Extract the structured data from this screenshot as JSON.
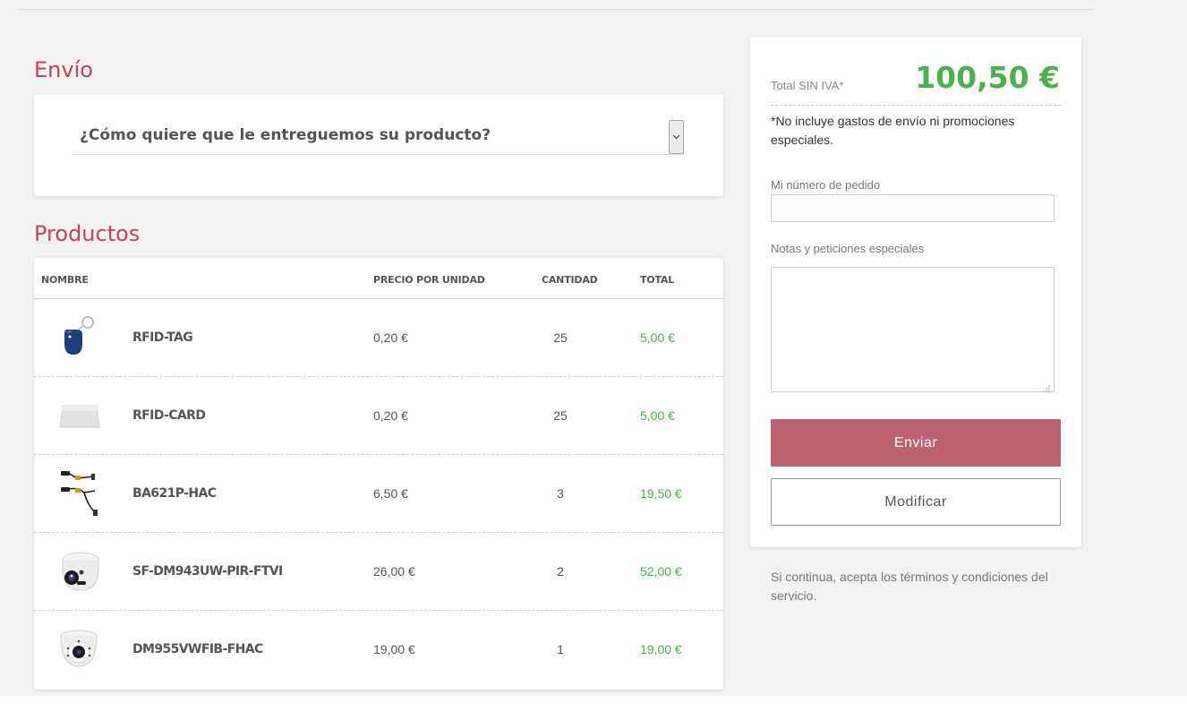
{
  "shipping": {
    "title": "Envío",
    "select_label": "¿Cómo quiere que le entreguemos su producto?"
  },
  "products": {
    "title": "Productos",
    "columns": {
      "name": "NOMBRE",
      "unit_price": "PRECIO POR UNIDAD",
      "quantity": "CANTIDAD",
      "total": "TOTAL"
    },
    "rows": [
      {
        "name": "RFID-TAG",
        "unit_price": "0,20 €",
        "quantity": "25",
        "total": "5,00 €",
        "image": "rfid-keyfob"
      },
      {
        "name": "RFID-CARD",
        "unit_price": "0,20 €",
        "quantity": "25",
        "total": "5,00 €",
        "image": "rfid-card"
      },
      {
        "name": "BA621P-HAC",
        "unit_price": "6,50 €",
        "quantity": "3",
        "total": "19,50 €",
        "image": "video-balun-cables"
      },
      {
        "name": "SF-DM943UW-PIR-FTVI",
        "unit_price": "26,00 €",
        "quantity": "2",
        "total": "52,00 €",
        "image": "turret-camera"
      },
      {
        "name": "DM955VWFIB-FHAC",
        "unit_price": "19,00 €",
        "quantity": "1",
        "total": "19,00 €",
        "image": "dome-camera"
      }
    ]
  },
  "summary": {
    "total_label": "Total SIN IVA*",
    "total_value": "100,50 €",
    "note": "*No incluye gastos de envío ni promociones especiales.",
    "order_number_label": "Mi número de pedido",
    "order_number_value": "",
    "notes_label": "Notas y peticiones especiales",
    "notes_value": "",
    "send_label": "Enviar",
    "modify_label": "Modificar"
  },
  "terms": "Si continua, acepta los términos y condiciones del servicio.",
  "colors": {
    "accent": "#c2415c",
    "price_green": "#4caf50",
    "send_button": "#bd6271",
    "page_background": "#f2f2f2"
  }
}
